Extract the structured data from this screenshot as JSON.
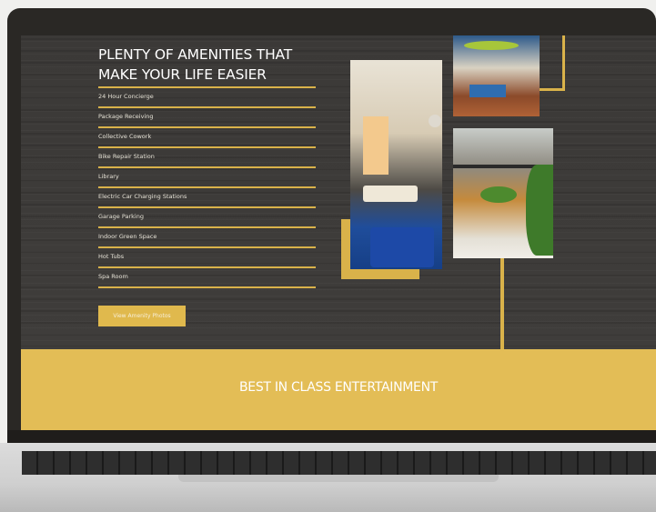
{
  "section": {
    "heading_line1": "PLENTY OF AMENITIES THAT",
    "heading_line2": "MAKE YOUR LIFE EASIER"
  },
  "amenities": [
    "24 Hour Concierge",
    "Package Receiving",
    "Collective Cowork",
    "Bike Repair Station",
    "Library",
    "Electric Car Charging Stations",
    "Garage Parking",
    "Indoor Green Space",
    "Hot Tubs",
    "Spa Room"
  ],
  "cta": {
    "label": "View Amenity Photos"
  },
  "banner": {
    "title": "BEST IN CLASS ENTERTAINMENT"
  },
  "colors": {
    "accent": "#d9b24a",
    "banner": "#e3bd56",
    "background": "#3d3b3a",
    "text": "#ffffff"
  }
}
